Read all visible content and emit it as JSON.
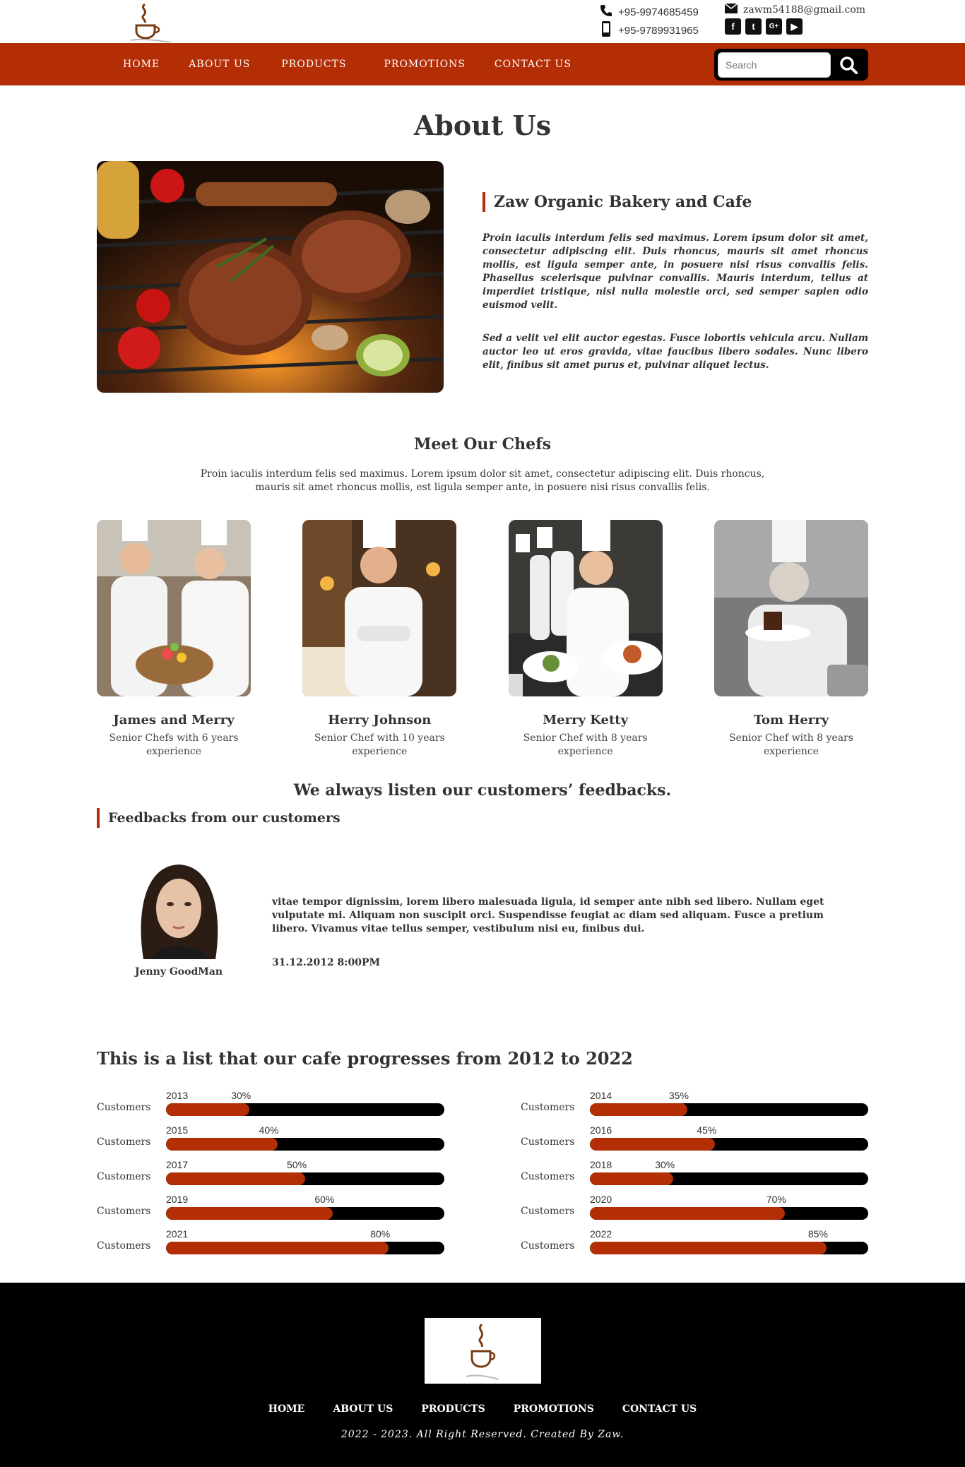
{
  "header": {
    "phone1": "+95-9974685459",
    "phone2": "+95-9789931965",
    "email": "zawm54188@gmail.com",
    "social": [
      "facebook-icon",
      "twitter-icon",
      "google-plus-icon",
      "youtube-icon"
    ]
  },
  "nav": {
    "items": [
      "HOME",
      "ABOUT US",
      "PRODUCTS",
      "PROMOTIONS",
      "CONTACT US"
    ],
    "search_placeholder": "Search"
  },
  "page_title": "About Us",
  "about": {
    "heading": "Zaw Organic Bakery and Cafe",
    "p1": "Proin iaculis interdum felis sed maximus. Lorem ipsum dolor sit amet, consectetur adipiscing elit. Duis rhoncus, mauris sit amet rhoncus mollis, est ligula semper ante, in posuere nisi risus convallis felis. Phasellus scelerisque pulvinar convallis. Mauris interdum, tellus at imperdiet tristique, nisl nulla molestie orci, sed semper sapien odio euismod velit.",
    "p2": "Sed a velit vel elit auctor egestas. Fusce lobortis vehicula arcu. Nullam auctor leo ut eros gravida, vitae faucibus libero sodales. Nunc libero elit, finibus sit amet purus et, pulvinar aliquet lectus."
  },
  "chefs": {
    "title": "Meet Our Chefs",
    "intro": "Proin iaculis interdum felis sed maximus. Lorem ipsum dolor sit amet, consectetur adipiscing elit. Duis rhoncus, mauris sit amet rhoncus mollis, est ligula semper ante, in posuere nisi risus convallis felis.",
    "items": [
      {
        "name": "James and Merry",
        "desc": "Senior Chefs with 6 years experience"
      },
      {
        "name": "Herry Johnson",
        "desc": "Senior Chef with 10 years experience"
      },
      {
        "name": "Merry Ketty",
        "desc": "Senior Chef with 8 years experience"
      },
      {
        "name": "Tom Herry",
        "desc": "Senior Chef with 8 years experience"
      }
    ]
  },
  "feedback": {
    "headline": "We always listen our customers’ feedbacks.",
    "title": "Feedbacks from our customers",
    "name": "Jenny GoodMan",
    "text": "vitae tempor dignissim, lorem libero malesuada ligula, id semper ante nibh sed libero. Nullam eget vulputate mi. Aliquam non suscipit orci. Suspendisse feugiat ac diam sed aliquam. Fusce a pretium libero. Vivamus vitae tellus semper, vestibulum nisi eu, finibus dui.",
    "date": "31.12.2012 8:00PM"
  },
  "progress": {
    "title": "This is a list that our cafe progresses from 2012 to 2022",
    "items": [
      {
        "label": "Customers",
        "year": "2013",
        "pct_text": "30%",
        "value": 30
      },
      {
        "label": "Customers",
        "year": "2014",
        "pct_text": "35%",
        "value": 35
      },
      {
        "label": "Customers",
        "year": "2015",
        "pct_text": "40%",
        "value": 40
      },
      {
        "label": "Customers",
        "year": "2016",
        "pct_text": "45%",
        "value": 45
      },
      {
        "label": "Customers",
        "year": "2017",
        "pct_text": "50%",
        "value": 50
      },
      {
        "label": "Customers",
        "year": "2018",
        "pct_text": "30%",
        "value": 30
      },
      {
        "label": "Customers",
        "year": "2019",
        "pct_text": "60%",
        "value": 60
      },
      {
        "label": "Customers",
        "year": "2020",
        "pct_text": "70%",
        "value": 70
      },
      {
        "label": "Customers",
        "year": "2021",
        "pct_text": "80%",
        "value": 80
      },
      {
        "label": "Customers",
        "year": "2022",
        "pct_text": "85%",
        "value": 85
      }
    ]
  },
  "footer": {
    "links": [
      "HOME",
      "ABOUT US",
      "PRODUCTS",
      "PROMOTIONS",
      "CONTACT US"
    ],
    "copyright": "2022 - 2023. All Right Reserved. Created By Zaw."
  },
  "colors": {
    "accent": "#b32d05",
    "dark": "#000000"
  }
}
